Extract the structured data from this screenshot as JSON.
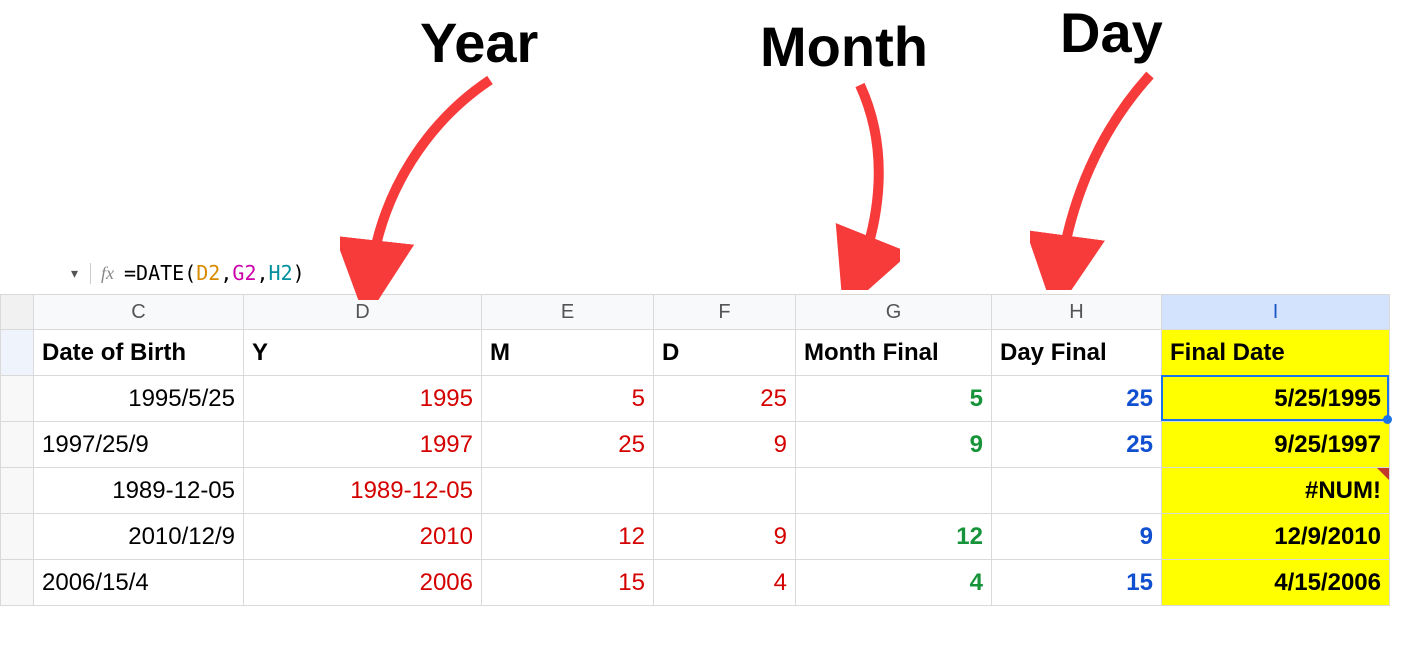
{
  "annotations": {
    "year": "Year",
    "month": "Month",
    "day": "Day"
  },
  "formula_bar": {
    "fx": "fx",
    "prefix": "=",
    "fn": "DATE",
    "open": "(",
    "arg1": "D2",
    "comma1": ",",
    "arg2": "G2",
    "comma2": ",",
    "arg3": "H2",
    "close": ")"
  },
  "columns": {
    "gutter": "",
    "C": "C",
    "D": "D",
    "E": "E",
    "F": "F",
    "G": "G",
    "H": "H",
    "I": "I",
    "selected": "I"
  },
  "headers": {
    "C": "Date of Birth",
    "D": "Y",
    "E": "M",
    "F": "D",
    "G": "Month Final",
    "H": "Day Final",
    "I": "Final Date"
  },
  "rows": [
    {
      "C": "1995/5/25",
      "C_align": "right",
      "D": "1995",
      "E": "5",
      "F": "25",
      "G": "5",
      "H": "25",
      "I": "5/25/1995",
      "active": true
    },
    {
      "C": "1997/25/9",
      "C_align": "left",
      "D": "1997",
      "E": "25",
      "F": "9",
      "G": "9",
      "H": "25",
      "I": "9/25/1997"
    },
    {
      "C": "1989-12-05",
      "C_align": "right",
      "D": "1989-12-05",
      "E": "",
      "F": "",
      "G": "",
      "H": "",
      "I": "#NUM!",
      "err": true
    },
    {
      "C": "2010/12/9",
      "C_align": "right",
      "D": "2010",
      "E": "12",
      "F": "9",
      "G": "12",
      "H": "9",
      "I": "12/9/2010"
    },
    {
      "C": "2006/15/4",
      "C_align": "left",
      "D": "2006",
      "E": "15",
      "F": "4",
      "G": "4",
      "H": "15",
      "I": "4/15/2006"
    }
  ]
}
